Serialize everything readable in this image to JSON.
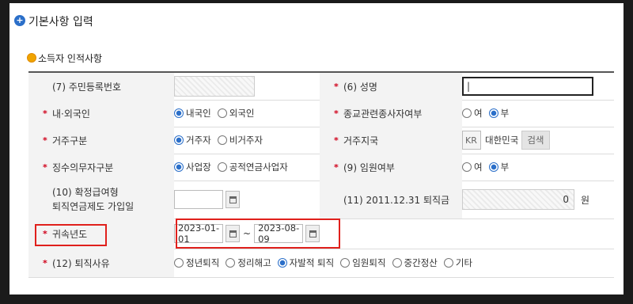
{
  "section": {
    "title": "기본사항 입력",
    "subtitle": "소득자 인적사항",
    "title_icon": "plus-circle-icon",
    "subtitle_icon": "bullet-icon"
  },
  "rows": {
    "r1": {
      "l1": "(7) 주민등록번호",
      "l2": "(6) 성명",
      "name_value": "|"
    },
    "r2": {
      "l1": "내·외국인",
      "o1": "내국인",
      "o2": "외국인",
      "l2": "종교관련종사자여부",
      "o3": "여",
      "o4": "부"
    },
    "r3": {
      "l1": "거주구분",
      "o1": "거주자",
      "o2": "비거주자",
      "l2": "거주지국",
      "code": "KR",
      "country": "대한민국",
      "search": "검색"
    },
    "r4": {
      "l1": "징수의무자구분",
      "o1": "사업장",
      "o2": "공적연금사업자",
      "l2": "(9) 임원여부",
      "o3": "여",
      "o4": "부"
    },
    "r5": {
      "l1a": "(10) 확정급여형",
      "l1b": "퇴직연금제도 가입일",
      "l2": "(11) 2011.12.31 퇴직금",
      "amount": "0",
      "unit": "원"
    },
    "r6": {
      "l1": "귀속년도",
      "from": "2023-01-01",
      "tilde": "~",
      "to": "2023-08-09"
    },
    "r7": {
      "l1": "(12) 퇴직사유",
      "o1": "정년퇴직",
      "o2": "정리해고",
      "o3": "자발적 퇴직",
      "o4": "임원퇴직",
      "o5": "중간정산",
      "o6": "기타"
    }
  },
  "colors": {
    "accent": "#2b6fc9",
    "required": "#d0021b",
    "highlight": "#e0201c"
  }
}
